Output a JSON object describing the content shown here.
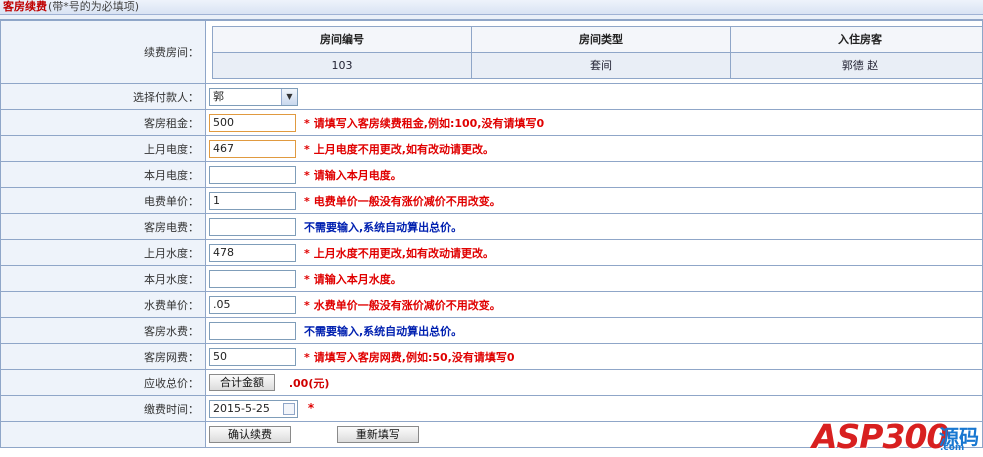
{
  "header": {
    "title": "客房续费",
    "note": "(带*号的为必填项)"
  },
  "room": {
    "label": "续费房间：",
    "columns": [
      "房间编号",
      "房间类型",
      "入住房客"
    ],
    "row": [
      "103",
      "套间",
      "郭德  赵"
    ]
  },
  "payer": {
    "label": "选择付款人：",
    "value": "郭"
  },
  "fields": [
    {
      "label": "客房租金：",
      "value": "500",
      "tip": "请填写入客房续费租金,例如:100,没有请填写0",
      "tip_color": "red",
      "star": true,
      "highlight": true
    },
    {
      "label": "上月电度：",
      "value": "467",
      "tip": "上月电度不用更改,如有改动请更改。",
      "tip_color": "red",
      "star": true,
      "highlight": true
    },
    {
      "label": "本月电度：",
      "value": "",
      "tip": "请输入本月电度。",
      "tip_color": "red",
      "star": true,
      "highlight": false
    },
    {
      "label": "电费单价：",
      "value": "1",
      "tip": "电费单价一般没有涨价减价不用改变。",
      "tip_color": "red",
      "star": true,
      "highlight": false
    },
    {
      "label": "客房电费：",
      "value": "",
      "tip": "不需要输入,系统自动算出总价。",
      "tip_color": "blue",
      "star": false,
      "highlight": false
    },
    {
      "label": "上月水度：",
      "value": "478",
      "tip": "上月水度不用更改,如有改动请更改。",
      "tip_color": "red",
      "star": true,
      "highlight": false
    },
    {
      "label": "本月水度：",
      "value": "",
      "tip": "请输入本月水度。",
      "tip_color": "red",
      "star": true,
      "highlight": false
    },
    {
      "label": "水费单价：",
      "value": ".05",
      "tip": "水费单价一般没有涨价减价不用改变。",
      "tip_color": "red",
      "star": true,
      "highlight": false
    },
    {
      "label": "客房水费：",
      "value": "",
      "tip": "不需要输入,系统自动算出总价。",
      "tip_color": "blue",
      "star": false,
      "highlight": false
    },
    {
      "label": "客房网费：",
      "value": "50",
      "tip": "请填写入客房网费,例如:50,没有请填写0",
      "tip_color": "red",
      "star": true,
      "highlight": false
    }
  ],
  "total": {
    "label": "应收总价：",
    "button": "合计金额",
    "value": ".00(元)"
  },
  "date": {
    "label": "缴费时间：",
    "value": "2015-5-25",
    "star": "*"
  },
  "actions": {
    "confirm": "确认续费",
    "reset": "重新填写"
  },
  "star_symbol": "*",
  "watermark": {
    "brand": "ASP300",
    "cn": "源码",
    "domain": ".com"
  }
}
